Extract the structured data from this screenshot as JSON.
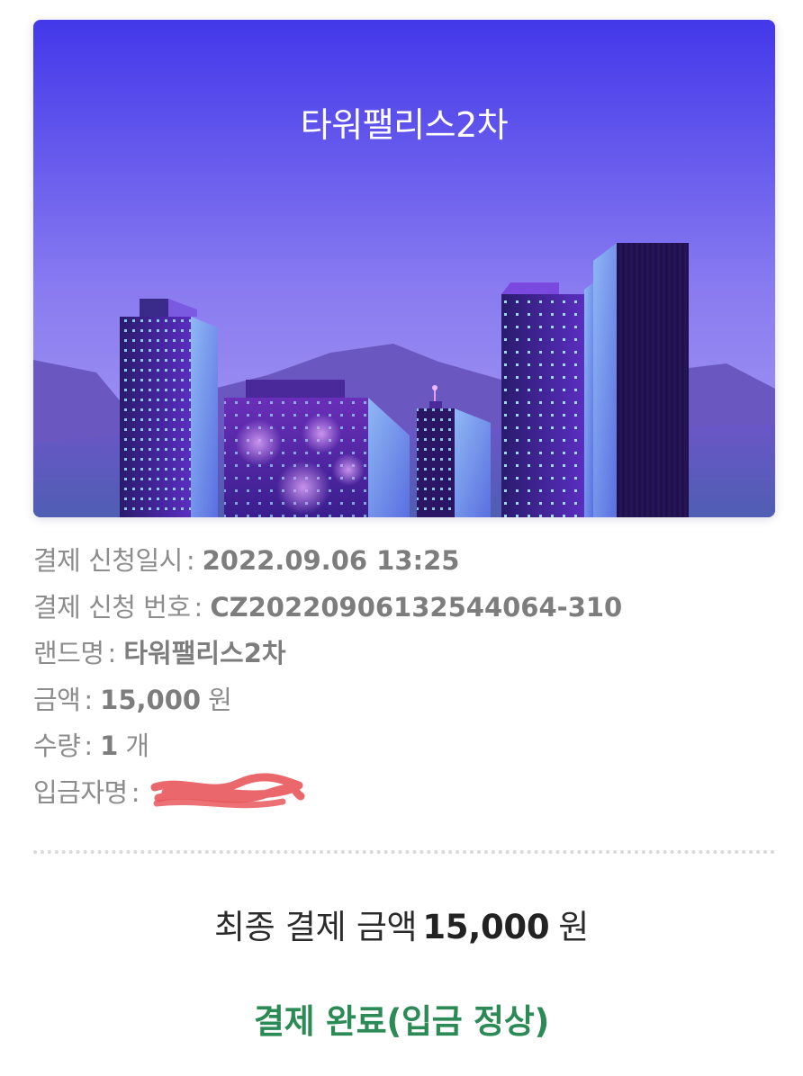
{
  "banner": {
    "title": "타워팰리스2차"
  },
  "details": {
    "separator": ":",
    "rows": [
      {
        "label": "결제 신청일시",
        "value": "2022.09.06 13:25",
        "unit": ""
      },
      {
        "label": "결제 신청 번호",
        "value": "CZ20220906132544064-310",
        "unit": ""
      },
      {
        "label": "랜드명",
        "value": "타워팰리스2차",
        "unit": ""
      },
      {
        "label": "금액",
        "value": "15,000",
        "unit": "원"
      },
      {
        "label": "수량",
        "value": "1",
        "unit": "개"
      },
      {
        "label": "입금자명",
        "value": "",
        "unit": ""
      }
    ]
  },
  "summary": {
    "label": "최종 결제 금액",
    "amount": "15,000",
    "unit": "원"
  },
  "status": {
    "text": "결제 완료(입금 정상)",
    "color": "#2b8a55"
  },
  "colors": {
    "sky_top": "#4338ea",
    "sky_bottom": "#a89cf2",
    "redaction": "#e8585c"
  }
}
